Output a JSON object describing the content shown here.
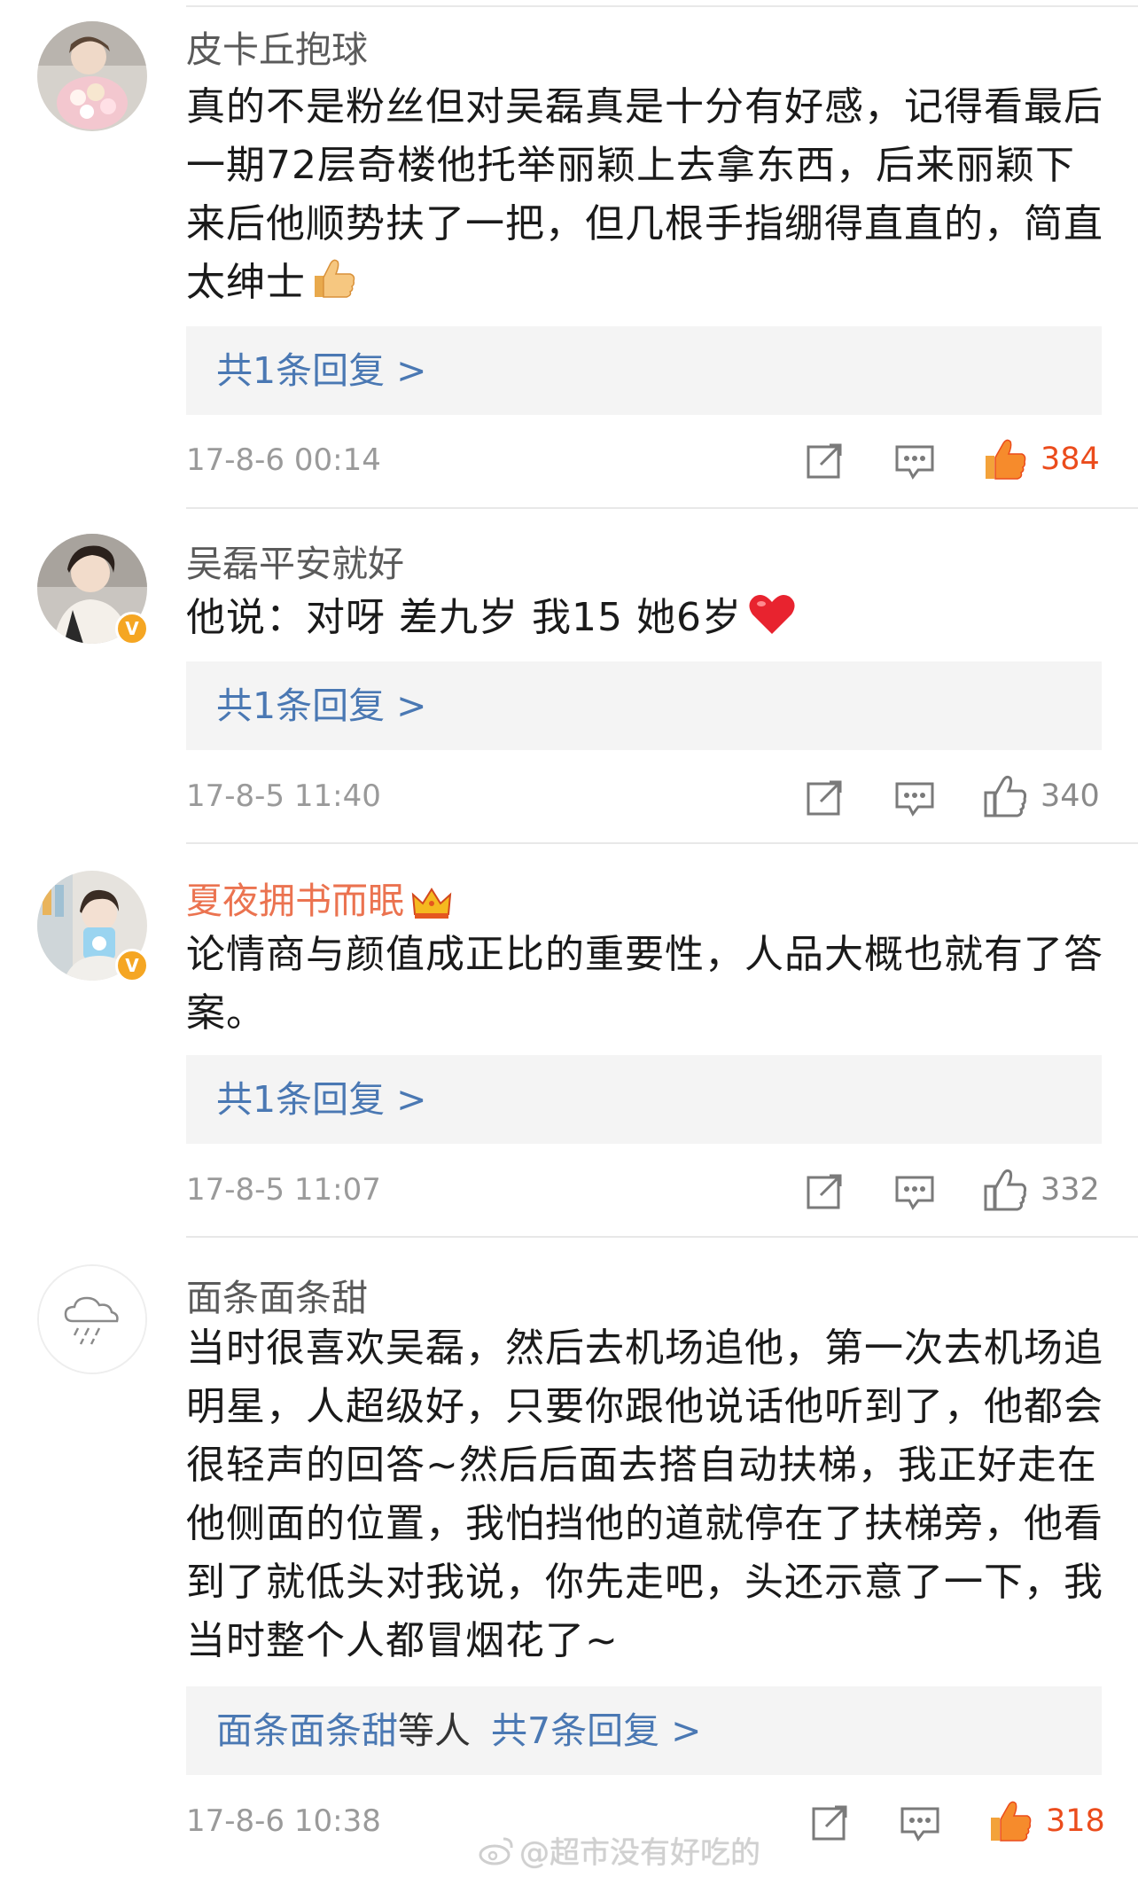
{
  "comments": [
    {
      "username": "皮卡丘抱球",
      "text": "真的不是粉丝但对吴磊真是十分有好感，记得看最后一期72层奇楼他托举丽颖上去拿东西，后来丽颖下来后他顺势扶了一把，但几根手指绷得直直的，简直太绅士",
      "text_emoji": "thumbs-up",
      "reply_prefix": "",
      "reply_label": "共1条回复 >",
      "time": "17-8-6 00:14",
      "likes": "384",
      "liked": true
    },
    {
      "username": "吴磊平安就好",
      "text": "他说：对呀 差九岁 我15 她6岁",
      "text_emoji": "red-heart",
      "reply_prefix": "",
      "reply_label": "共1条回复 >",
      "time": "17-8-5 11:40",
      "likes": "340",
      "liked": false
    },
    {
      "username": "夏夜拥书而眠",
      "text": "论情商与颜值成正比的重要性，人品大概也就有了答案。",
      "text_emoji": "",
      "reply_prefix": "",
      "reply_label": "共1条回复 >",
      "time": "17-8-5 11:07",
      "likes": "332",
      "liked": false
    },
    {
      "username": "面条面条甜",
      "text": "当时很喜欢吴磊，然后去机场追他，第一次去机场追明星，人超级好，只要你跟他说话他听到了，他都会很轻声的回答~然后后面去搭自动扶梯，我正好走在他侧面的位置，我怕挡他的道就停在了扶梯旁，他看到了就低头对我说，你先走吧，头还示意了一下，我当时整个人都冒烟花了~",
      "text_emoji": "",
      "reply_prefix": "面条面条甜",
      "reply_middle": "等人",
      "reply_label": "共7条回复 >",
      "time": "17-8-6 10:38",
      "likes": "318",
      "liked": true
    }
  ],
  "watermark": "@超市没有好吃的",
  "colors": {
    "link": "#4a78b3",
    "vip_name": "#eb7350",
    "like_active": "#eb4c1c",
    "badge": "#f5a623"
  },
  "icons": [
    "share-icon",
    "comment-icon",
    "like-icon",
    "thumbs-up-emoji",
    "red-heart-emoji",
    "crown-icon",
    "weibo-logo-icon",
    "verified-badge",
    "cloud-rain-avatar-icon"
  ]
}
